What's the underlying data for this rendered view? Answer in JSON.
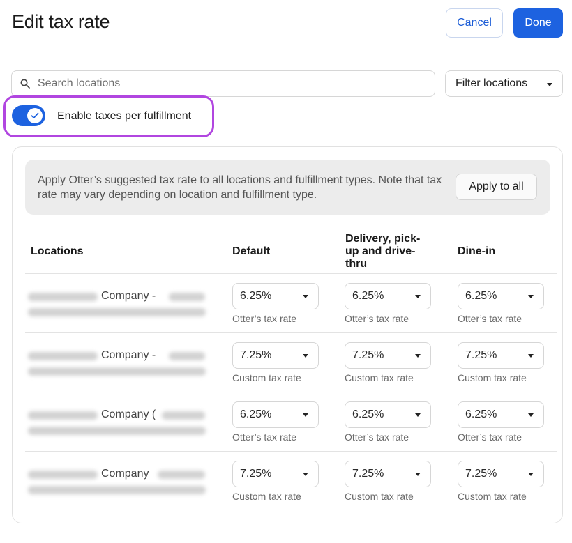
{
  "header": {
    "title": "Edit tax rate",
    "cancel_label": "Cancel",
    "done_label": "Done"
  },
  "search": {
    "placeholder": "Search locations",
    "filter_label": "Filter locations"
  },
  "toggle": {
    "label": "Enable taxes per fulfillment",
    "enabled": true
  },
  "banner": {
    "text": "Apply Otter’s suggested tax rate to all locations and fulfillment types. Note that tax rate may vary depending on location and fulfillment type.",
    "apply_label": "Apply to all"
  },
  "table": {
    "headers": {
      "locations": "Locations",
      "default": "Default",
      "delivery": "Delivery, pick-up and drive-thru",
      "dinein": "Dine-in"
    },
    "rows": [
      {
        "name": "Company -",
        "default": {
          "rate": "6.25%",
          "type": "Otter’s tax rate"
        },
        "delivery": {
          "rate": "6.25%",
          "type": "Otter’s tax rate"
        },
        "dinein": {
          "rate": "6.25%",
          "type": "Otter’s tax rate"
        }
      },
      {
        "name": "Company -",
        "default": {
          "rate": "7.25%",
          "type": "Custom tax rate"
        },
        "delivery": {
          "rate": "7.25%",
          "type": "Custom tax rate"
        },
        "dinein": {
          "rate": "7.25%",
          "type": "Custom tax rate"
        }
      },
      {
        "name": "Company (",
        "default": {
          "rate": "6.25%",
          "type": "Otter’s tax rate"
        },
        "delivery": {
          "rate": "6.25%",
          "type": "Otter’s tax rate"
        },
        "dinein": {
          "rate": "6.25%",
          "type": "Otter’s tax rate"
        }
      },
      {
        "name": "Company",
        "default": {
          "rate": "7.25%",
          "type": "Custom tax rate"
        },
        "delivery": {
          "rate": "7.25%",
          "type": "Custom tax rate"
        },
        "dinein": {
          "rate": "7.25%",
          "type": "Custom tax rate"
        }
      }
    ]
  },
  "colors": {
    "accent": "#1d62e0",
    "highlight": "#b146e0"
  }
}
